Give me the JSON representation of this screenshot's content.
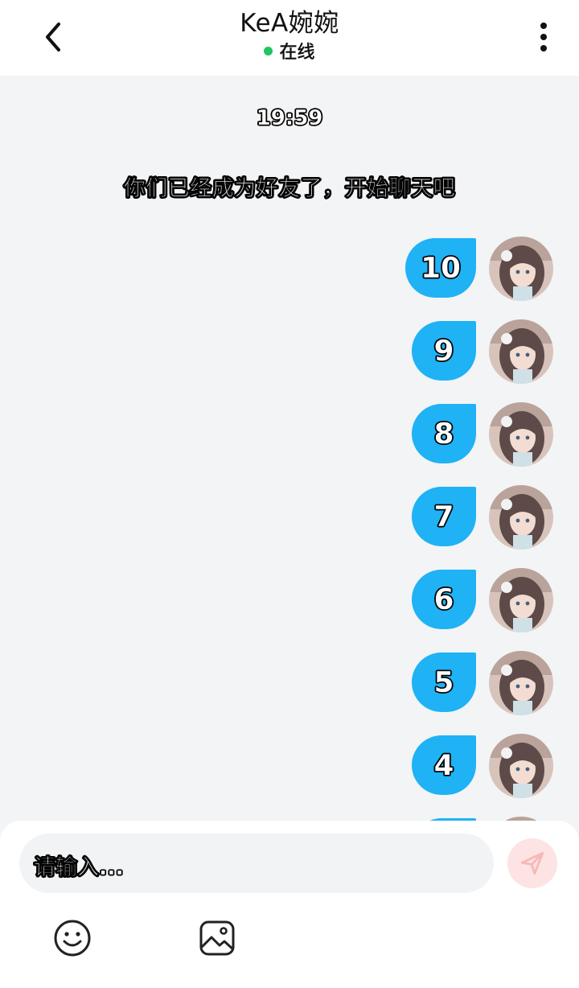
{
  "header": {
    "back_icon": "chevron-left-icon",
    "title": "KeA婉婉",
    "status": {
      "text": "在线",
      "color": "#22c55e"
    },
    "more_icon": "more-vertical-icon"
  },
  "chat": {
    "timestamp": "19:59",
    "system_notice": "你们已经成为好友了，开始聊天吧",
    "messages": [
      {
        "text": "10"
      },
      {
        "text": "9"
      },
      {
        "text": "8"
      },
      {
        "text": "7"
      },
      {
        "text": "6"
      },
      {
        "text": "5"
      },
      {
        "text": "4"
      },
      {
        "text": ""
      }
    ],
    "bubble_color": "#1fb2f5"
  },
  "composer": {
    "input_value": "",
    "input_placeholder": "请输入...",
    "send_icon": "send-icon",
    "send_color": "#fde3e3",
    "tools": [
      {
        "icon": "emoji-icon"
      },
      {
        "icon": "image-icon"
      }
    ]
  }
}
